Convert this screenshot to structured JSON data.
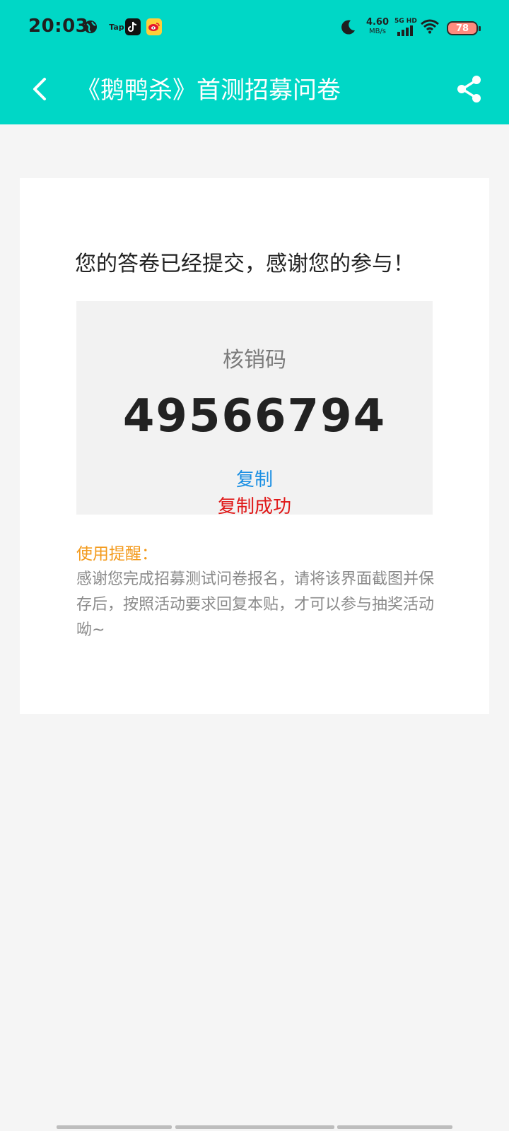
{
  "status_bar": {
    "time": "20:03",
    "speed_value": "4.60",
    "speed_unit": "MB/s",
    "network_label": "5G HD",
    "battery": "78",
    "tap_label": "Tap",
    "icons": [
      "globe-icon",
      "tap-icon",
      "tiktok-icon",
      "weibo-icon",
      "moon-icon",
      "signal-icon",
      "wifi-icon",
      "battery-icon"
    ]
  },
  "header": {
    "title": "《鹅鸭杀》首测招募问卷",
    "back_icon": "chevron-left-icon",
    "share_icon": "share-icon",
    "background": "#00d7c6"
  },
  "result": {
    "message": "您的答卷已经提交，感谢您的参与！",
    "code_label": "核销码",
    "code": "49566794",
    "copy_label": "复制",
    "copy_success": "复制成功"
  },
  "tip": {
    "title": "使用提醒：",
    "body": "感谢您完成招募测试问卷报名，请将该界面截图并保存后，按照活动要求回复本贴，才可以参与抽奖活动呦~"
  },
  "colors": {
    "accent": "#00d7c6",
    "link": "#1a8fe3",
    "success": "#e01818",
    "tip_title": "#f39a1c"
  }
}
